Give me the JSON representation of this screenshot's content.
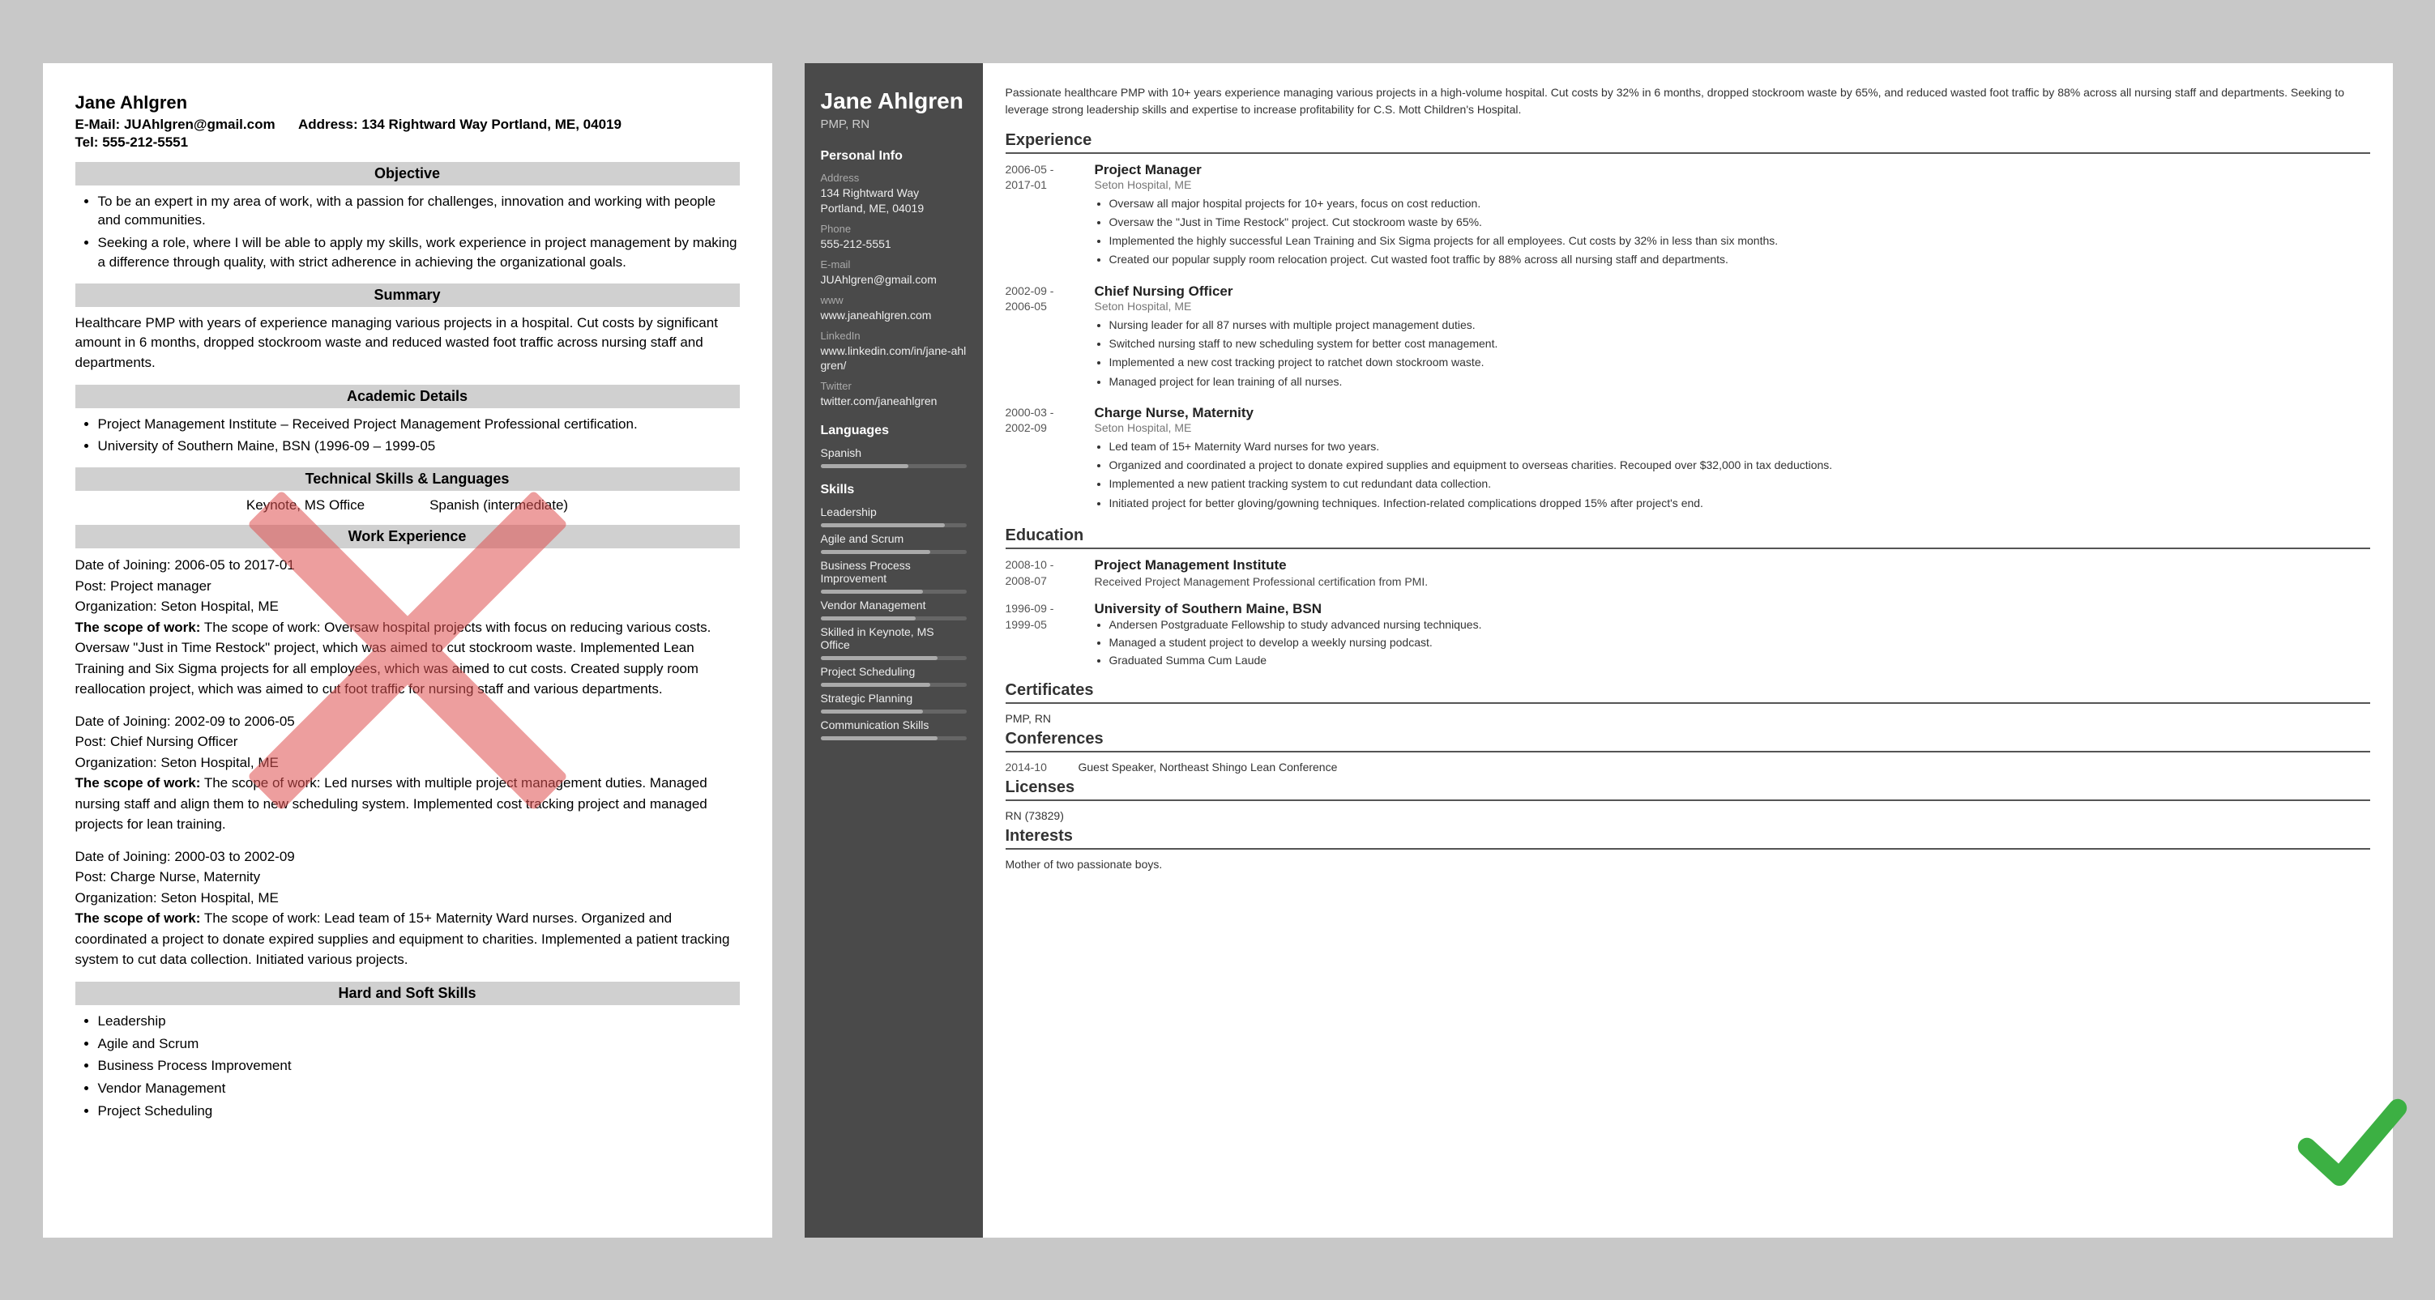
{
  "bad_resume": {
    "name": "Jane Ahlgren",
    "email_label": "E-Mail:",
    "email": "JUAhlgren@gmail.com",
    "address_label": "Address:",
    "address": "134 Rightward Way Portland, ME, 04019",
    "tel_label": "Tel:",
    "tel": "555-212-5551",
    "sections": {
      "objective": {
        "title": "Objective",
        "bullets": [
          "To be an expert in my area of work, with a passion for challenges, innovation and working with people and communities.",
          "Seeking a role, where I will be able to apply my skills, work experience in project management by making a difference through quality, with strict adherence in achieving the organizational goals."
        ]
      },
      "summary": {
        "title": "Summary",
        "text": "Healthcare PMP with years of experience managing various projects in a hospital. Cut costs by significant amount in 6 months, dropped stockroom waste and reduced wasted foot traffic across nursing staff and departments."
      },
      "academic": {
        "title": "Academic Details",
        "bullets": [
          "Project Management Institute – Received Project Management Professional certification.",
          "University of Southern Maine, BSN (1996-09 – 1999-05"
        ]
      },
      "technical": {
        "title": "Technical Skills & Languages",
        "skills": [
          "Keynote, MS Office",
          "Spanish (intermediate)"
        ]
      },
      "work": {
        "title": "Work Experience",
        "entries": [
          {
            "dates": "Date of Joining: 2006-05 to 2017-01",
            "post": "Post: Project manager",
            "org": "Organization: Seton Hospital, ME",
            "scope": "The scope of work: Oversaw hospital projects with focus on reducing various costs. Oversaw \"Just in Time Restock\" project, which was aimed to cut stockroom waste. Implemented Lean Training and Six Sigma projects for all employees, which was aimed to cut costs. Created supply room reallocation project, which was aimed to cut foot traffic for nursing staff and various departments."
          },
          {
            "dates": "Date of Joining: 2002-09 to 2006-05",
            "post": "Post: Chief Nursing Officer",
            "org": "Organization: Seton Hospital, ME",
            "scope": "The scope of work: Led nurses with multiple project management duties. Managed nursing staff and align them to new scheduling system. Implemented cost tracking project and managed projects for lean training."
          },
          {
            "dates": "Date of Joining: 2000-03 to 2002-09",
            "post": "Post: Charge Nurse, Maternity",
            "org": "Organization: Seton Hospital, ME",
            "scope": "The scope of work: Lead team of 15+ Maternity Ward nurses. Organized and coordinated a project to donate expired supplies and equipment to charities. Implemented a patient tracking system to cut data collection. Initiated various projects."
          }
        ]
      },
      "skills": {
        "title": "Hard and Soft Skills",
        "bullets": [
          "Leadership",
          "Agile and Scrum",
          "Business Process Improvement",
          "Vendor Management",
          "Project Scheduling"
        ]
      }
    }
  },
  "good_resume": {
    "name": "Jane Ahlgren",
    "title": "PMP, RN",
    "summary": "Passionate healthcare PMP with 10+ years experience managing various projects in a high-volume hospital. Cut costs by 32% in 6 months, dropped stockroom waste by 65%, and reduced wasted foot traffic by 88% across all nursing staff and departments. Seeking to leverage strong leadership skills and expertise to increase profitability for C.S. Mott Children's Hospital.",
    "sidebar": {
      "personal_info_title": "Personal Info",
      "address_label": "Address",
      "address": "134 Rightward Way\nPortland, ME, 04019",
      "phone_label": "Phone",
      "phone": "555-212-5551",
      "email_label": "E-mail",
      "email": "JUAhlgren@gmail.com",
      "www_label": "www",
      "www": "www.janeahlgren.com",
      "linkedin_label": "LinkedIn",
      "linkedin": "www.linkedin.com/in/jane-ahlgren/",
      "twitter_label": "Twitter",
      "twitter": "twitter.com/janeahlgren",
      "languages_title": "Languages",
      "language": "Spanish",
      "language_bar": 60,
      "skills_title": "Skills",
      "skills": [
        {
          "name": "Leadership",
          "bar": 85
        },
        {
          "name": "Agile and Scrum",
          "bar": 75
        },
        {
          "name": "Business Process Improvement",
          "bar": 70
        },
        {
          "name": "Vendor Management",
          "bar": 65
        },
        {
          "name": "Skilled in Keynote, MS Office",
          "bar": 80
        },
        {
          "name": "Project Scheduling",
          "bar": 75
        },
        {
          "name": "Strategic Planning",
          "bar": 70
        },
        {
          "name": "Communication Skills",
          "bar": 80
        }
      ]
    },
    "experience": {
      "title": "Experience",
      "entries": [
        {
          "dates": "2006-05 -\n2017-01",
          "job": "Project Manager",
          "org": "Seton Hospital, ME",
          "bullets": [
            "Oversaw all major hospital projects for 10+ years, focus on cost reduction.",
            "Oversaw the \"Just in Time Restock\" project. Cut stockroom waste by 65%.",
            "Implemented the highly successful Lean Training and Six Sigma projects for all employees. Cut costs by 32% in less than six months.",
            "Created our popular supply room relocation project. Cut wasted foot traffic by 88% across all nursing staff and departments."
          ]
        },
        {
          "dates": "2002-09 -\n2006-05",
          "job": "Chief Nursing Officer",
          "org": "Seton Hospital, ME",
          "bullets": [
            "Nursing leader for all 87 nurses with multiple project management duties.",
            "Switched nursing staff to new scheduling system for better cost management.",
            "Implemented a new cost tracking project to ratchet down stockroom waste.",
            "Managed project for lean training of all nurses."
          ]
        },
        {
          "dates": "2000-03 -\n2002-09",
          "job": "Charge Nurse, Maternity",
          "org": "Seton Hospital, ME",
          "bullets": [
            "Led team of 15+ Maternity Ward nurses for two years.",
            "Organized and coordinated a project to donate expired supplies and equipment to overseas charities. Recouped over $32,000 in tax deductions.",
            "Implemented a new patient tracking system to cut redundant data collection.",
            "Initiated project for better gloving/gowning techniques. Infection-related complications dropped 15% after project's end."
          ]
        }
      ]
    },
    "education": {
      "title": "Education",
      "entries": [
        {
          "dates": "2008-10 -\n2008-07",
          "inst": "Project Management Institute",
          "detail": "Received Project Management Professional certification from PMI."
        },
        {
          "dates": "1996-09 -\n1999-05",
          "inst": "University of Southern Maine, BSN",
          "bullets": [
            "Andersen Postgraduate Fellowship to study advanced nursing techniques.",
            "Managed a student project to develop a weekly nursing podcast.",
            "Graduated Summa Cum Laude"
          ]
        }
      ]
    },
    "certificates": {
      "title": "Certificates",
      "value": "PMP, RN"
    },
    "conferences": {
      "title": "Conferences",
      "entries": [
        {
          "date": "2014-10",
          "desc": "Guest Speaker, Northeast Shingo Lean Conference"
        }
      ]
    },
    "licenses": {
      "title": "Licenses",
      "value": "RN (73829)"
    },
    "interests": {
      "title": "Interests",
      "value": "Mother of two passionate boys."
    }
  }
}
